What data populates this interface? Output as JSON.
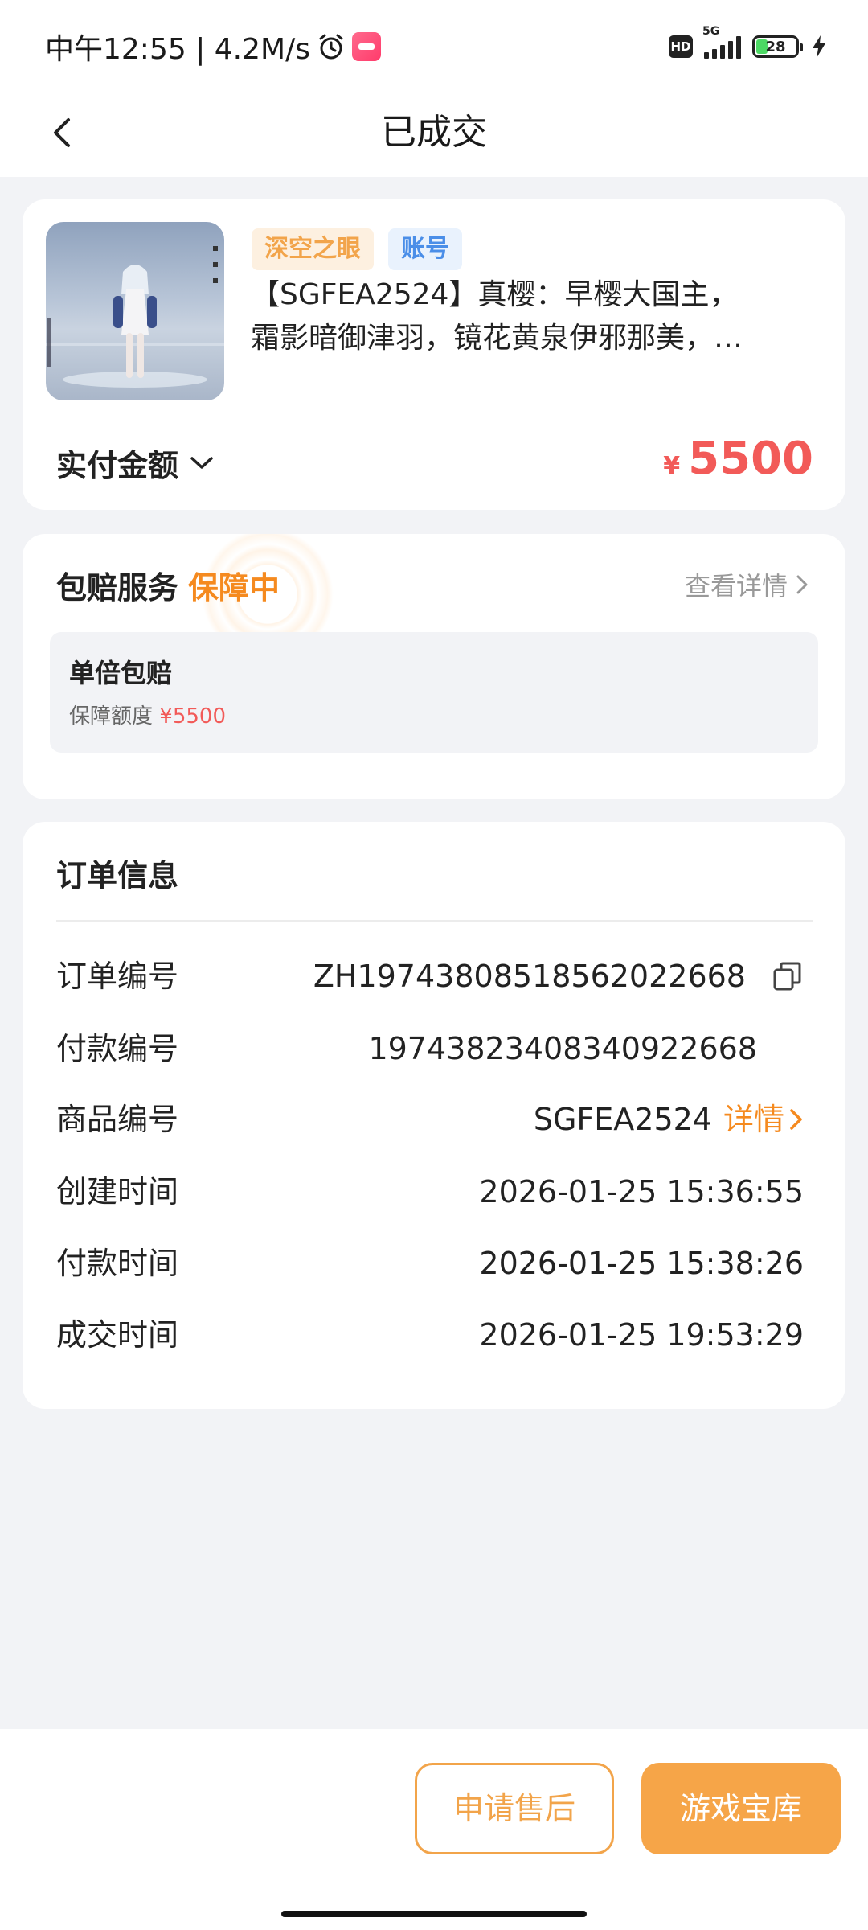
{
  "status_bar": {
    "time_speed": "中午12:55 | 4.2M/s",
    "network": "5G",
    "hd": "HD",
    "battery": "28"
  },
  "header": {
    "title": "已成交"
  },
  "product": {
    "tag_game": "深空之眼",
    "tag_type": "账号",
    "title": "【SGFEA2524】真樱：早樱大国主，\n霜影暗御津羽，镜花黄泉伊邪那美，…",
    "amount_label": "实付金额",
    "currency": "¥",
    "amount": "5500"
  },
  "guarantee": {
    "title": "包赔服务",
    "status": "保障中",
    "detail_link": "查看详情",
    "plan_title": "单倍包赔",
    "limit_label": "保障额度",
    "limit_value": "¥5500"
  },
  "order": {
    "title": "订单信息",
    "rows": [
      {
        "label": "订单编号",
        "value": "ZH1974380851856202266​8"
      },
      {
        "label": "付款编号",
        "value": "1974382340834092266​8"
      },
      {
        "label": "商品编号",
        "value": "SGFEA2524",
        "link": "详情"
      },
      {
        "label": "创建时间",
        "value": "2026-01-25 15:36:55"
      },
      {
        "label": "付款时间",
        "value": "2026-01-25 15:38:26"
      },
      {
        "label": "成交时间",
        "value": "2026-01-25 19:53:29"
      }
    ]
  },
  "actions": {
    "after_sale": "申请售后",
    "vault": "游戏宝库"
  },
  "colors": {
    "accent_orange": "#f58a1f",
    "price_red": "#f25a58",
    "button_orange": "#f6a548"
  }
}
